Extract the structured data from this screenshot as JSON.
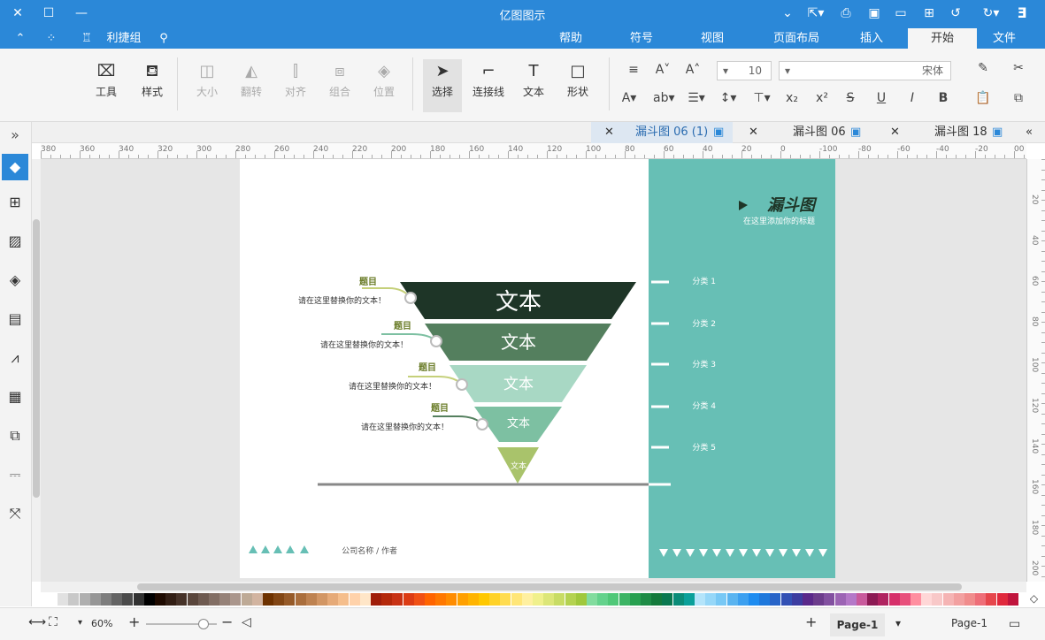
{
  "app": {
    "title": "亿图图示"
  },
  "menu": {
    "tabs": [
      "文件",
      "开始",
      "插入",
      "页面布局",
      "视图",
      "符号",
      "帮助"
    ],
    "active": "开始",
    "extra_label": "利捷组"
  },
  "ribbon": {
    "font_name": "宋体",
    "font_size": "10",
    "tools": {
      "select": "选择",
      "connector": "连接线",
      "text": "文本",
      "shape": "形状",
      "position": "位置",
      "group": "组合",
      "align": "对齐",
      "rotate": "翻转",
      "size": "大小",
      "style": "样式",
      "tool": "工具"
    }
  },
  "doc_tabs": [
    {
      "label": "漏斗图 18",
      "active": false
    },
    {
      "label": "漏斗图 06",
      "active": false
    },
    {
      "label": "漏斗图 06 (1)",
      "active": true
    }
  ],
  "ruler_h": [
    "00",
    "-20",
    "-40",
    "-60",
    "-80",
    "-100",
    "0",
    "20",
    "40",
    "60",
    "80",
    "100",
    "120",
    "140",
    "160",
    "180",
    "200",
    "220",
    "240",
    "260",
    "280",
    "300",
    "320",
    "340",
    "360",
    "380"
  ],
  "ruler_v": [
    "20",
    "40",
    "60",
    "80",
    "100",
    "120",
    "140",
    "160",
    "180",
    "200"
  ],
  "diagram": {
    "title": "漏斗图",
    "subtitle": "在这里添加你的标题",
    "categories": [
      "分类 1",
      "分类 2",
      "分类 3",
      "分类 4",
      "分类 5"
    ],
    "layers": [
      {
        "text": "文本",
        "heading": "题目",
        "desc": "请在这里替换你的文本！",
        "color": "#1e3527"
      },
      {
        "text": "文本",
        "heading": "题目",
        "desc": "请在这里替换你的文本！",
        "color": "#547f5e"
      },
      {
        "text": "文本",
        "heading": "题目",
        "desc": "请在这里替换你的文本！",
        "color": "#a8d8c4"
      },
      {
        "text": "文本",
        "heading": "题目",
        "desc": "请在这里替换你的文本！",
        "color": "#7dc0a2"
      },
      {
        "text": "文本",
        "color": "#a9c36b"
      }
    ],
    "footer": "公司名称 / 作者",
    "panel_color": "#67bfb5"
  },
  "status": {
    "page_name": "Page-1",
    "page_tab": "Page-1",
    "zoom": "60%"
  },
  "palette": [
    "#c0143c",
    "#e0283c",
    "#e6464c",
    "#ee6e78",
    "#f08c8c",
    "#f2a0a0",
    "#f5b4b4",
    "#f8c8c8",
    "#ffd7d7",
    "#ff8fa0",
    "#e8507c",
    "#d62f6a",
    "#b02360",
    "#8c1a54",
    "#c85a9c",
    "#b478c8",
    "#9c64b4",
    "#8250a0",
    "#6c3c8c",
    "#5a288a",
    "#3c3ca0",
    "#3250b4",
    "#2864c8",
    "#1e78dc",
    "#1e8cf0",
    "#3ca0f0",
    "#5ab4f0",
    "#78c8f5",
    "#96d7f8",
    "#b4e4fa",
    "#0aa09a",
    "#0a8c78",
    "#0a7850",
    "#147a3c",
    "#1e8c46",
    "#28a050",
    "#3cb464",
    "#50c878",
    "#64d28c",
    "#82dc9e",
    "#a0c83c",
    "#b4d250",
    "#c8dc64",
    "#dce678",
    "#f0f08c",
    "#fff0a0",
    "#ffe678",
    "#ffdc50",
    "#ffd228",
    "#ffc800",
    "#ffb400",
    "#ffa000",
    "#ff8c00",
    "#ff7800",
    "#ff6400",
    "#f05014",
    "#dc3c14",
    "#c83214",
    "#b4280a",
    "#a01e0a",
    "#ffe6c8",
    "#ffd2aa",
    "#f5be8c",
    "#e6aa78",
    "#d29664",
    "#be8250",
    "#aa6e3c",
    "#965a28",
    "#824614",
    "#6e3200",
    "#d2b4a0",
    "#beaa96",
    "#aa968c",
    "#968278",
    "#826e64",
    "#6e5a50",
    "#5a463c",
    "#463228",
    "#321e14",
    "#1e0a00",
    "#000000",
    "#323232",
    "#4b4b4b",
    "#646464",
    "#7d7d7d",
    "#969696",
    "#afafaf",
    "#c8c8c8",
    "#e1e1e1",
    "#ffffff"
  ]
}
